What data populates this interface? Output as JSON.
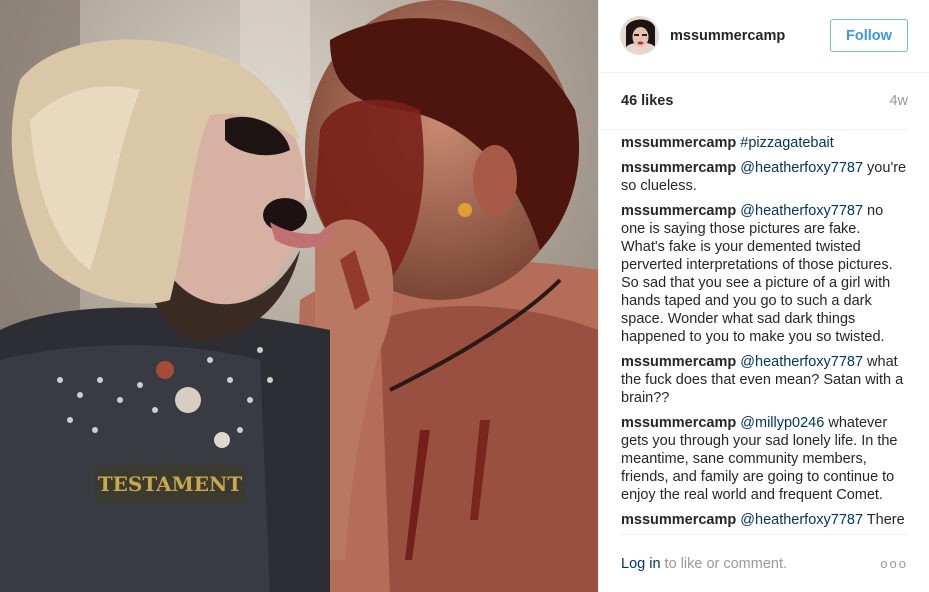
{
  "post": {
    "username": "mssummercamp",
    "follow_label": "Follow",
    "likes": "46 likes",
    "age": "4w"
  },
  "comments": [
    {
      "user": "mssummercamp",
      "tag": "#pizzagatebait",
      "text": ""
    },
    {
      "user": "mssummercamp",
      "tag": "@heatherfoxy7787",
      "text": " you're so clueless."
    },
    {
      "user": "mssummercamp",
      "tag": "@heatherfoxy7787",
      "text": " no one is saying those pictures are fake. What's fake is your demented twisted perverted interpretations of those pictures. So sad that you see a picture of a girl with hands taped and you go to such a dark space. Wonder what sad dark things happened to you to make you so twisted."
    },
    {
      "user": "mssummercamp",
      "tag": "@heatherfoxy7787",
      "text": " what the fuck does that even mean? Satan with a brain??"
    },
    {
      "user": "mssummercamp",
      "tag": "@millyp0246",
      "text": " whatever gets you through your sad lonely life. In the meantime, sane community members, friends, and family are going to continue to enjoy the real world and frequent Comet."
    },
    {
      "user": "mssummercamp",
      "tag": "@heatherfoxy7787",
      "text": " There"
    }
  ],
  "footer": {
    "login_label": "Log in",
    "rest_label": " to like or comment.",
    "more_label": "ooo"
  },
  "photo": {
    "patch_text": "TESTAMENT"
  }
}
